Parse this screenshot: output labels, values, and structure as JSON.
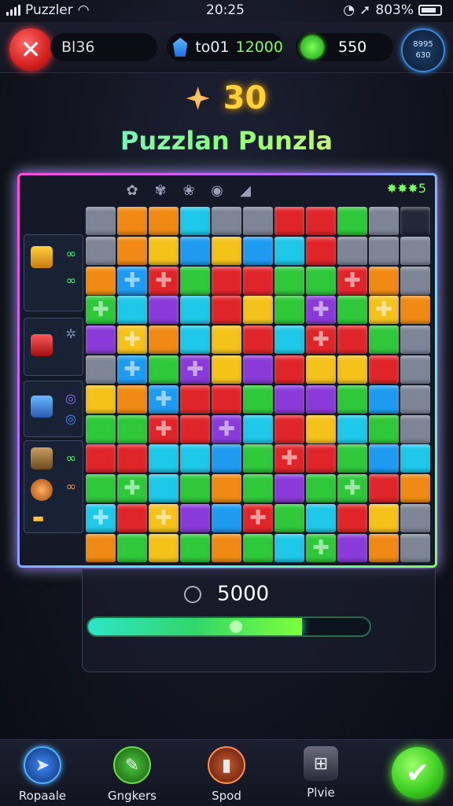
{
  "status_bar": {
    "carrier": "Puzzler",
    "time": "20:25",
    "battery": "803%"
  },
  "top_bar": {
    "close_label": "✕",
    "pill1": "Bl36",
    "pill2_prefix": "to01",
    "pill2_value": "12000",
    "coins": "550",
    "avatar_line1": "8995",
    "avatar_line2": "630"
  },
  "header": {
    "score": "30",
    "title": "Puzzlan Punzla"
  },
  "board": {
    "tools": [
      "✿",
      "✾",
      "❀",
      "◉",
      "◢"
    ],
    "stars_label": "✸✸✸5",
    "colors": {
      "R": "#e0252a",
      "O": "#f08a14",
      "Y": "#f5c21c",
      "G": "#2ec83a",
      "B": "#1e9bf0",
      "C": "#1fc8e8",
      "P": "#8a3ad8",
      "S": "#7d8596",
      "K": "#232838"
    },
    "rows": [
      [
        "S",
        "O",
        "O",
        "C",
        "S",
        "S",
        "R",
        "R",
        "G",
        "S",
        "K"
      ],
      [
        "S",
        "O",
        "Y",
        "B",
        "Y",
        "B",
        "C",
        "R",
        "S",
        "S",
        "S"
      ],
      [
        "O",
        "B",
        "R",
        "G",
        "R",
        "R",
        "G",
        "G",
        "R",
        "O",
        "S"
      ],
      [
        "G",
        "C",
        "P",
        "C",
        "R",
        "Y",
        "G",
        "P",
        "G",
        "Y",
        "O"
      ],
      [
        "P",
        "Y",
        "O",
        "C",
        "Y",
        "R",
        "C",
        "R",
        "R",
        "G",
        "S"
      ],
      [
        "S",
        "B",
        "G",
        "P",
        "Y",
        "P",
        "R",
        "Y",
        "Y",
        "R",
        "S"
      ],
      [
        "Y",
        "O",
        "B",
        "R",
        "R",
        "G",
        "P",
        "P",
        "G",
        "B",
        "S"
      ],
      [
        "G",
        "G",
        "R",
        "R",
        "P",
        "C",
        "R",
        "Y",
        "C",
        "G",
        "S"
      ],
      [
        "R",
        "R",
        "C",
        "C",
        "B",
        "G",
        "R",
        "R",
        "G",
        "B",
        "C"
      ],
      [
        "G",
        "G",
        "C",
        "G",
        "O",
        "G",
        "P",
        "G",
        "G",
        "R",
        "O"
      ],
      [
        "C",
        "R",
        "Y",
        "P",
        "B",
        "R",
        "G",
        "C",
        "R",
        "Y",
        "S"
      ],
      [
        "O",
        "G",
        "Y",
        "G",
        "O",
        "G",
        "C",
        "G",
        "P",
        "O",
        "S"
      ]
    ],
    "pieces": [
      [
        2,
        1
      ],
      [
        2,
        2
      ],
      [
        2,
        8
      ],
      [
        3,
        0
      ],
      [
        3,
        7
      ],
      [
        3,
        9
      ],
      [
        4,
        1
      ],
      [
        4,
        7
      ],
      [
        5,
        1
      ],
      [
        5,
        3
      ],
      [
        6,
        2
      ],
      [
        7,
        2
      ],
      [
        7,
        4
      ],
      [
        8,
        6
      ],
      [
        9,
        1
      ],
      [
        9,
        8
      ],
      [
        10,
        0
      ],
      [
        10,
        2
      ],
      [
        10,
        5
      ],
      [
        11,
        7
      ]
    ]
  },
  "progress": {
    "score": "5000",
    "fill_fraction": 0.76
  },
  "nav": {
    "items": [
      "Ropaale",
      "Gngkers",
      "Spod",
      "Plvie"
    ],
    "icons": [
      "compass-icon",
      "feather-icon",
      "book-icon",
      "controller-icon"
    ],
    "confirm_label": "✔"
  }
}
